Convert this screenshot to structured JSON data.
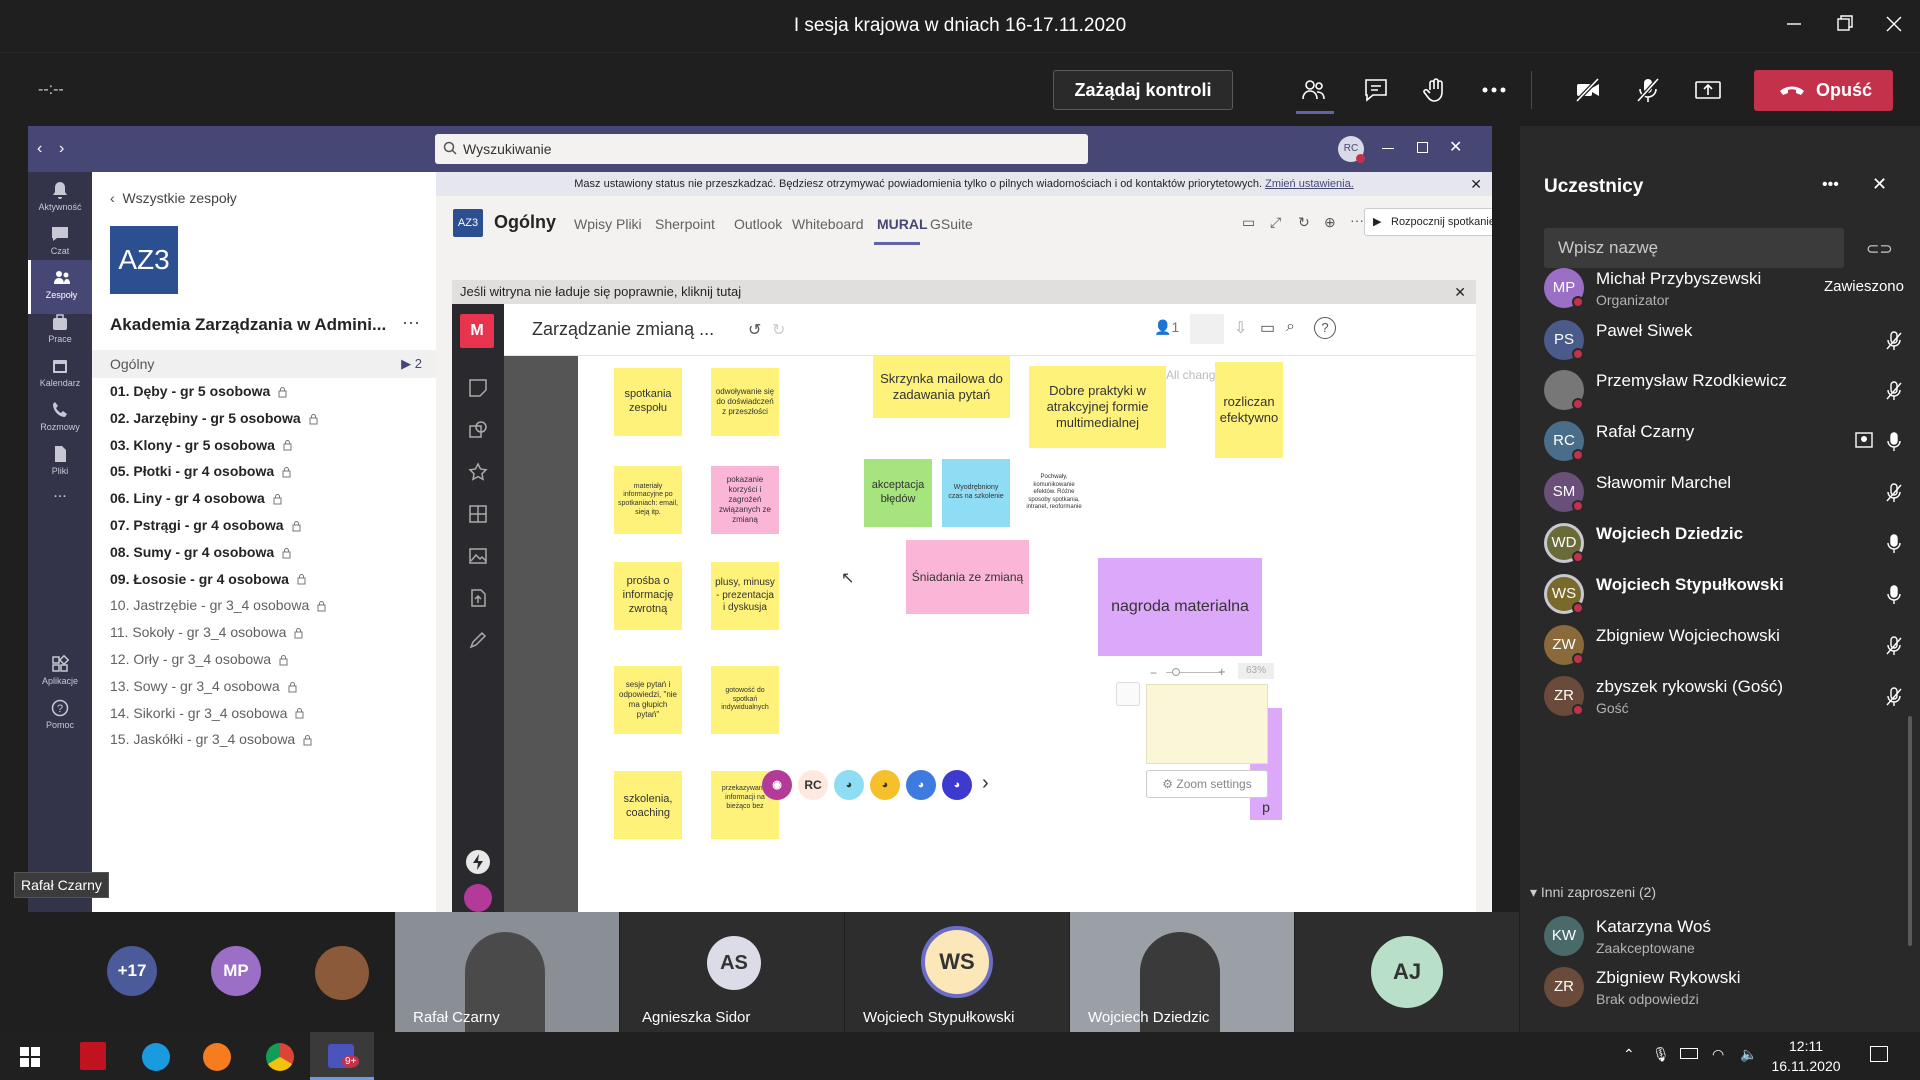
{
  "window": {
    "title": "I sesja krajowa w dniach 16-17.11.2020"
  },
  "toolbar": {
    "timer": "--:--",
    "request_control": "Zażądaj kontroli",
    "leave": "Opuść"
  },
  "teams": {
    "search_placeholder": "Wyszukiwanie",
    "user_initials": "RC",
    "rail": [
      "Aktywność",
      "Czat",
      "Zespoły",
      "Prace",
      "Kalendarz",
      "Rozmowy",
      "Pliki",
      "Aplikacje",
      "Pomoc"
    ],
    "rail_more": "...",
    "back": "Wszystkie zespoły",
    "team_badge": "AZ3",
    "team_name": "Akademia Zarządzania w Admini...",
    "team_more": "···",
    "general": "Ogólny",
    "general_count": "2",
    "channels": [
      {
        "name": "01. Dęby - gr 5 osobowa",
        "bold": true
      },
      {
        "name": "02. Jarzębiny - gr 5 osobowa",
        "bold": true
      },
      {
        "name": "03. Klony - gr 5 osobowa",
        "bold": true
      },
      {
        "name": "05. Płotki - gr 4 osobowa",
        "bold": true
      },
      {
        "name": "06. Liny - gr 4 osobowa",
        "bold": true
      },
      {
        "name": "07. Pstrągi - gr 4 osobowa",
        "bold": true
      },
      {
        "name": "08. Sumy - gr 4 osobowa",
        "bold": true
      },
      {
        "name": "09. Łososie - gr 4 osobowa",
        "bold": true
      },
      {
        "name": "10. Jastrzębie - gr 3_4 osobowa",
        "bold": false
      },
      {
        "name": "11. Sokoły - gr 3_4 osobowa",
        "bold": false
      },
      {
        "name": "12. Orły - gr 3_4 osobowa",
        "bold": false
      },
      {
        "name": "13. Sowy - gr 3_4 osobowa",
        "bold": false
      },
      {
        "name": "14. Sikorki - gr 3_4 osobowa",
        "bold": false
      },
      {
        "name": "15. Jaskółki - gr 3_4 osobowa",
        "bold": false
      }
    ],
    "banner": "Masz ustawiony status nie przeszkadzać. Będziesz otrzymywać powiadomienia tylko o pilnych wiadomościach i od kontaktów priorytetowych.",
    "banner_link": "Zmień ustawienia.",
    "channel_badge": "AZ3",
    "channel_name": "Ogólny",
    "tabs": [
      "Wpisy",
      "Pliki",
      "Sherpoint",
      "Outlook",
      "Whiteboard",
      "MURAL",
      "GSuite"
    ],
    "meet_button": "Rozpocznij spotkanie",
    "site_notice": "Jeśli witryna nie ładuje się poprawnie, kliknij tutaj"
  },
  "mural": {
    "logo": "M",
    "title": "Zarządzanie zmianą ...",
    "user_count": "1",
    "saved": "All changes saved",
    "zoom": "63%",
    "zoom_settings": "Zoom settings",
    "avatar_initials": "RC",
    "stickies": [
      "spotkania zespołu",
      "odwoływanie się do doświadczeń z przeszłości",
      "Skrzynka mailowa do zadawania pytań",
      "Dobre praktyki w atrakcyjnej formie multimedialnej",
      "rozliczan efektywno",
      "materiały informacyjne po spotkaniach: email, sieją itp.",
      "pokazanie korzyści i zagrożeń związanych ze zmianą",
      "akceptacja błędów",
      "Wyodrębniony czas na szkolenie",
      "Pochwały, komunikowanie efektów. Różne sposoby spotkania, intranet, reoformanie",
      "prośba o informację zwrotną",
      "plusy, minusy - prezentacja i dyskusja",
      "Śniadania ze zmianą",
      "nagroda materialna",
      "sesje pytań i odpowiedzi, \"nie ma głupich pytań\"",
      "gotowość do spotkań indywidualnych",
      "szkolenia, coaching",
      "przekazywanie informacji na bieżąco bez",
      "p"
    ]
  },
  "participants": {
    "title": "Uczestnicy",
    "more": "•••",
    "search_placeholder": "Wpisz nazwę",
    "list": [
      {
        "initials": "MP",
        "name": "Michał Przybyszewski",
        "sub": "Organizator",
        "status": "Zawieszono",
        "color": "#9b6fc6"
      },
      {
        "initials": "PS",
        "name": "Paweł Siwek",
        "sub": "",
        "status": "",
        "color": "#4a5a8a"
      },
      {
        "initials": "",
        "name": "Przemysław Rzodkiewicz",
        "sub": "",
        "status": "",
        "color": "#777777"
      },
      {
        "initials": "RC",
        "name": "Rafał Czarny",
        "sub": "",
        "status": "",
        "color": "#4a6e8a"
      },
      {
        "initials": "SM",
        "name": "Sławomir Marchel",
        "sub": "",
        "status": "",
        "color": "#6a4f7a"
      },
      {
        "initials": "WD",
        "name": "Wojciech Dziedzic",
        "sub": "",
        "status": "",
        "color": "#6b6b3a"
      },
      {
        "initials": "WS",
        "name": "Wojciech Stypułkowski",
        "sub": "",
        "status": "",
        "color": "#7a6a2a"
      },
      {
        "initials": "ZW",
        "name": "Zbigniew Wojciechowski",
        "sub": "",
        "status": "",
        "color": "#8a6a3a"
      },
      {
        "initials": "ZR",
        "name": "zbyszek rykowski (Gość)",
        "sub": "Gość",
        "status": "",
        "color": "#6a4a3a"
      }
    ],
    "others_header": "Inni zaproszeni (2)",
    "others": [
      {
        "initials": "KW",
        "name": "Katarzyna Woś",
        "sub": "Zaakceptowane",
        "color": "#4a6a6a"
      },
      {
        "initials": "ZR",
        "name": "Zbigniew Rykowski",
        "sub": "Brak odpowiedzi",
        "color": "#6a4a3a"
      }
    ]
  },
  "strip": {
    "more": "+17",
    "mp": "MP",
    "tiles": [
      {
        "name": "Rafał Czarny"
      },
      {
        "name": "Agnieszka Sidor",
        "initials": "AS"
      },
      {
        "name": "Wojciech Stypułkowski",
        "initials": "WS"
      },
      {
        "name": "Wojciech Dziedzic"
      },
      {
        "initials": "AJ"
      }
    ]
  },
  "tooltip": "Rafał Czarny",
  "taskbar": {
    "time": "12:11",
    "date": "16.11.2020",
    "teams_badge": "9+"
  },
  "colors": {
    "teams_purple": "#464775",
    "leave_red": "#c4314b",
    "mural_red": "#e8344e"
  }
}
